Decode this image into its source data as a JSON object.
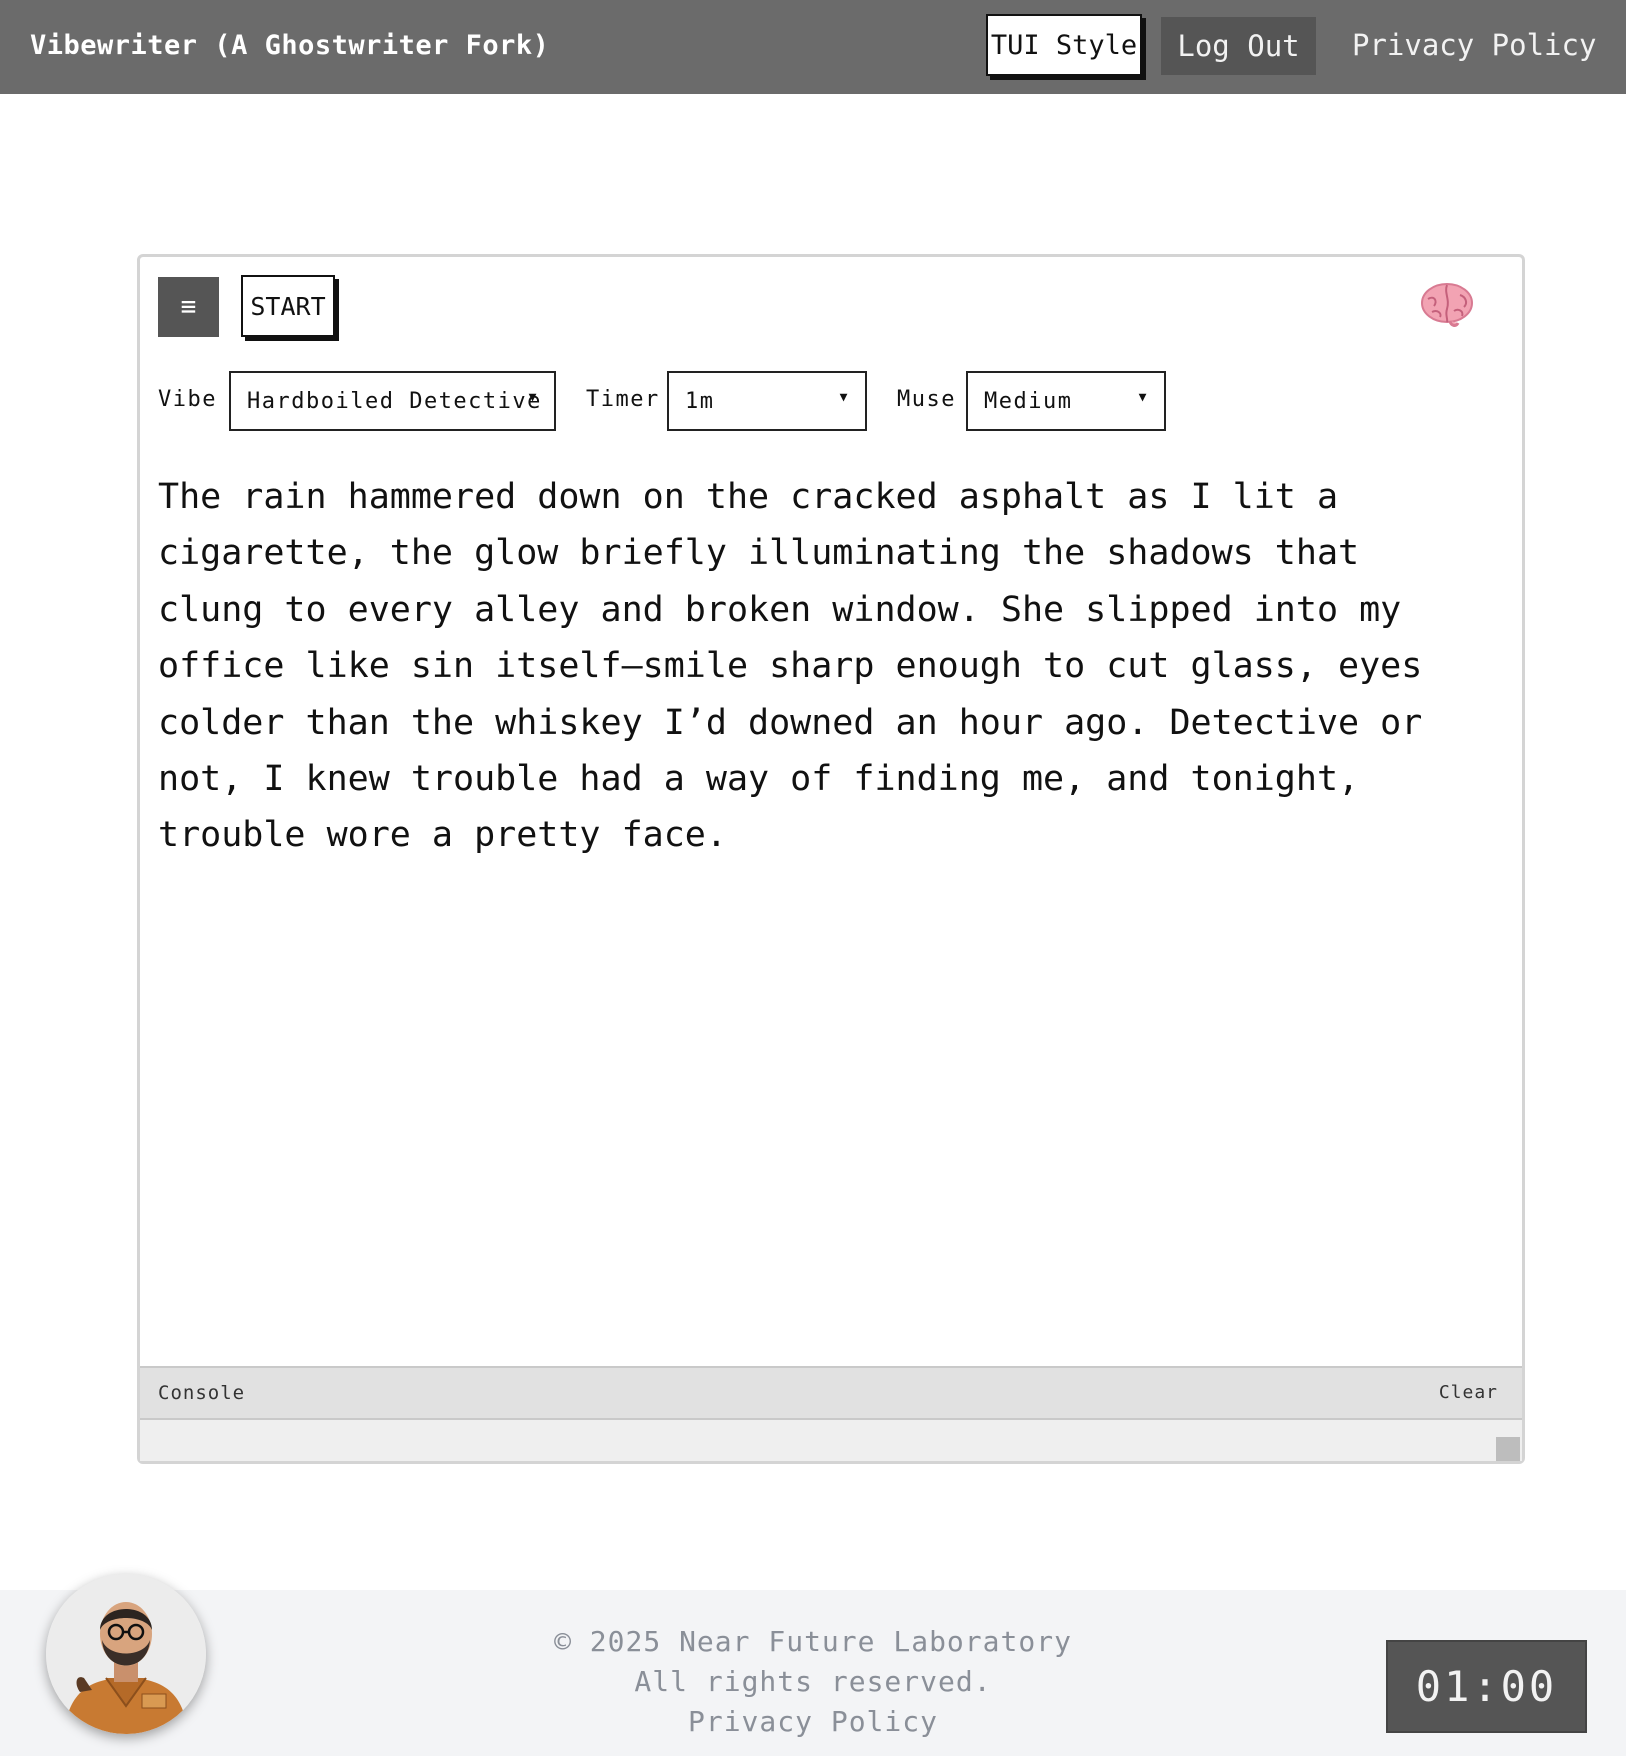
{
  "header": {
    "title": "Vibewriter (A Ghostwriter Fork)",
    "tui_style_label": "TUI Style",
    "logout_label": "Log Out",
    "privacy_label": "Privacy Policy"
  },
  "toolbar": {
    "menu_icon": "hamburger-icon",
    "start_label": "START",
    "brain_icon": "brain-icon"
  },
  "controls": {
    "vibe_label": "Vibe",
    "vibe_value": "Hardboiled Detective",
    "timer_label": "Timer",
    "timer_value": "1m",
    "muse_label": "Muse",
    "muse_value": "Medium"
  },
  "editor": {
    "text": "The rain hammered down on the cracked asphalt as I lit a\ncigarette, the glow briefly illuminating the shadows that\nclung to every alley and broken window. She slipped into my\noffice like sin itself—smile sharp enough to cut glass, eyes\ncolder than the whiskey I’d downed an hour ago. Detective or\nnot, I knew trouble had a way of finding me, and tonight,\ntrouble wore a pretty face."
  },
  "console": {
    "label": "Console",
    "clear_label": "Clear"
  },
  "footer": {
    "copyright": "© 2025 Near Future Laboratory",
    "rights": "All rights reserved.",
    "privacy": "Privacy Policy"
  },
  "timer_display": "01:00",
  "colors": {
    "topbar": "#6b6b6b",
    "dark_button": "#555555",
    "footer_bg": "#f3f4f6",
    "footer_text": "#8a8f98",
    "brain": "#f2a3b3"
  }
}
